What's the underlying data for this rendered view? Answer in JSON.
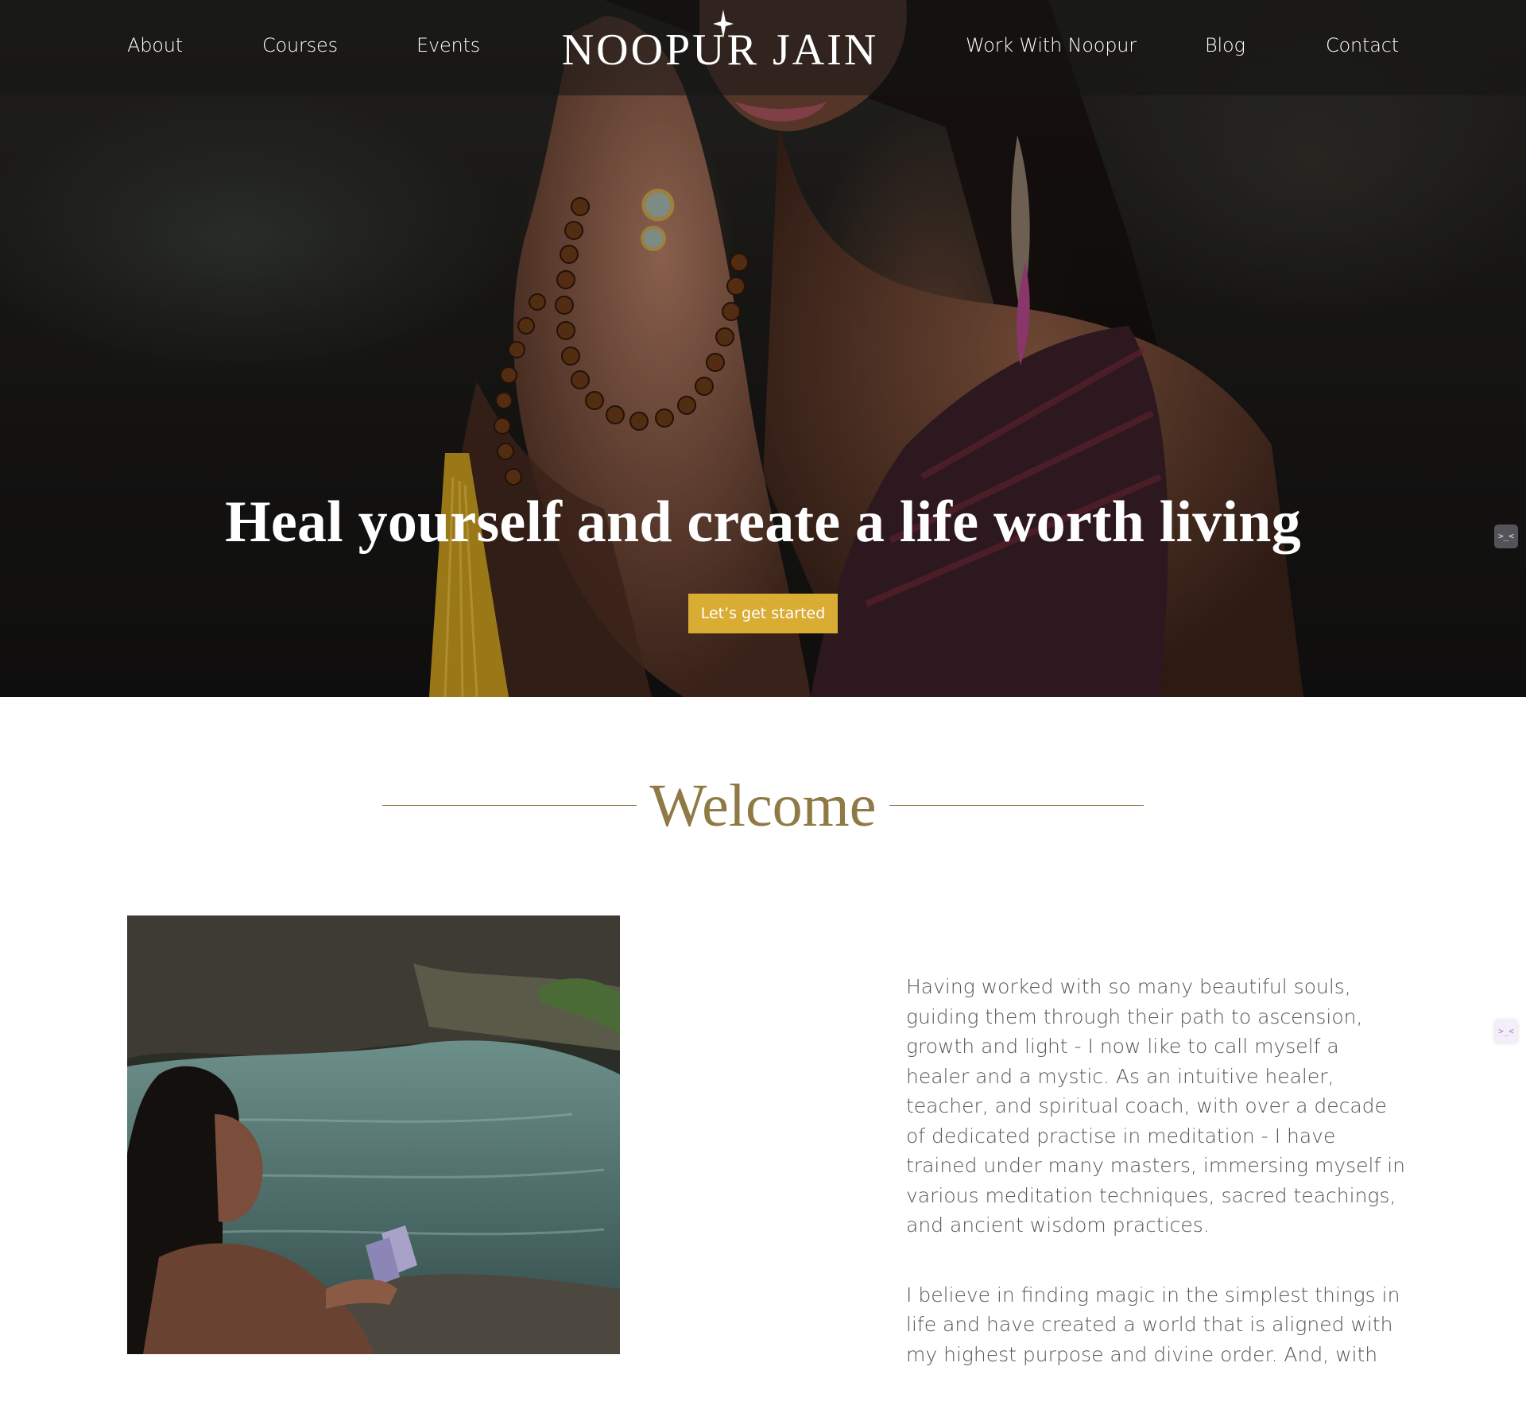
{
  "nav": {
    "left": [
      "About",
      "Courses",
      "Events"
    ],
    "right": [
      "Work With Noopur",
      "Blog",
      "Contact"
    ],
    "logo": "NOOPUR JAIN"
  },
  "hero": {
    "title": "Heal yourself and create a life worth living",
    "cta": "Let’s get started"
  },
  "widgets": {
    "icon_text": ">_<"
  },
  "welcome": {
    "title": "Welcome",
    "paragraphs": [
      "Having worked with so many beautiful souls, guiding them through their path to ascension, growth and light - I now like to call myself a healer and a mystic. As an intuitive healer, teacher, and spiritual coach, with over a decade of dedicated practise in meditation - I have trained under many masters, immersing myself in various meditation techniques, sacred teachings, and ancient wisdom practices.",
      "I believe in finding magic in the simplest things in life and have created a world that is aligned with my highest purpose and divine order. And, with"
    ]
  },
  "colors": {
    "accent_gold": "#d9ac33",
    "heading_gold": "#8f7a45",
    "body_text": "#55555a",
    "nav_bar": "rgba(20,20,20,0.55)"
  },
  "icons": {
    "logo_star": "four-point-star-icon",
    "side_widget": "assistant-widget-icon"
  }
}
